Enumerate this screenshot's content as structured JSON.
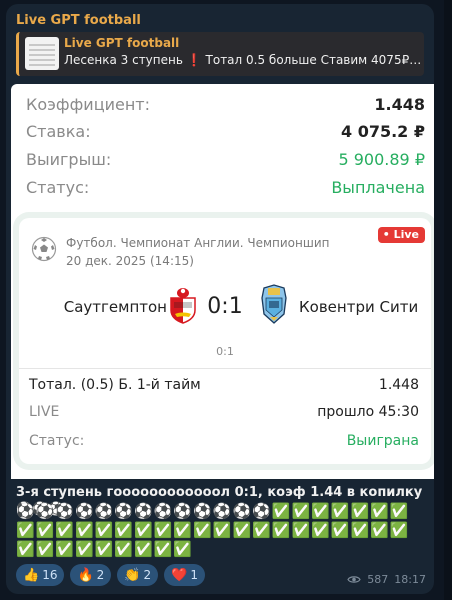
{
  "channel": {
    "name": "Live GPT football"
  },
  "reply": {
    "title": "Live GPT football",
    "text_before": "Лесенка 3 ступень ",
    "warn": "❗",
    "text_after": " Тотал 0.5 больше  Ставим 4075₽ ..."
  },
  "bet": {
    "coef_label": "Коэффициент:",
    "coef_value": "1.448",
    "stake_label": "Ставка:",
    "stake_value": "4 075.2 ₽",
    "win_label": "Выигрыш:",
    "win_value": "5 900.89 ₽",
    "status_label": "Статус:",
    "status_value": "Выплачена"
  },
  "match": {
    "live_badge": "• Live",
    "league": "Футбол. Чемпионат Англии. Чемпионшип",
    "date": "20 дек. 2025 (14:15)",
    "home": "Саутгемптон",
    "away": "Ковентри Сити",
    "score": "0:1",
    "score_small": "0:1",
    "market_label": "Тотал. (0.5) Б. 1-й тайм",
    "market_value": "1.448",
    "live_label": "LIVE",
    "live_value": "прошло 45:30",
    "status_label": "Статус:",
    "status_value": "Выиграна"
  },
  "message": {
    "text": "3-я ступень гоооооооооооол 0:1, коэф 1.44 в копилку ⚽⚽⚽",
    "emoji_line1": "⚽⚽⚽⚽⚽⚽⚽⚽⚽⚽⚽⚽⚽✅✅✅✅✅✅✅",
    "emoji_line2": "✅✅✅✅✅✅✅✅✅✅✅✅✅✅✅✅✅✅✅✅",
    "emoji_line3": "✅✅✅✅✅✅✅✅✅"
  },
  "reactions": [
    {
      "emoji": "👍",
      "count": "16"
    },
    {
      "emoji": "🔥",
      "count": "2"
    },
    {
      "emoji": "👏",
      "count": "2"
    },
    {
      "emoji": "❤️",
      "count": "1"
    }
  ],
  "meta": {
    "views": "587",
    "time": "18:17"
  },
  "colors": {
    "accent": "#e9a94a",
    "green": "#27ae60",
    "live_red": "#e53935",
    "reaction_bg": "#2b5278"
  },
  "icons": [
    "eye-icon",
    "soccer-ball-icon",
    "southampton-crest-icon",
    "coventry-crest-icon"
  ]
}
